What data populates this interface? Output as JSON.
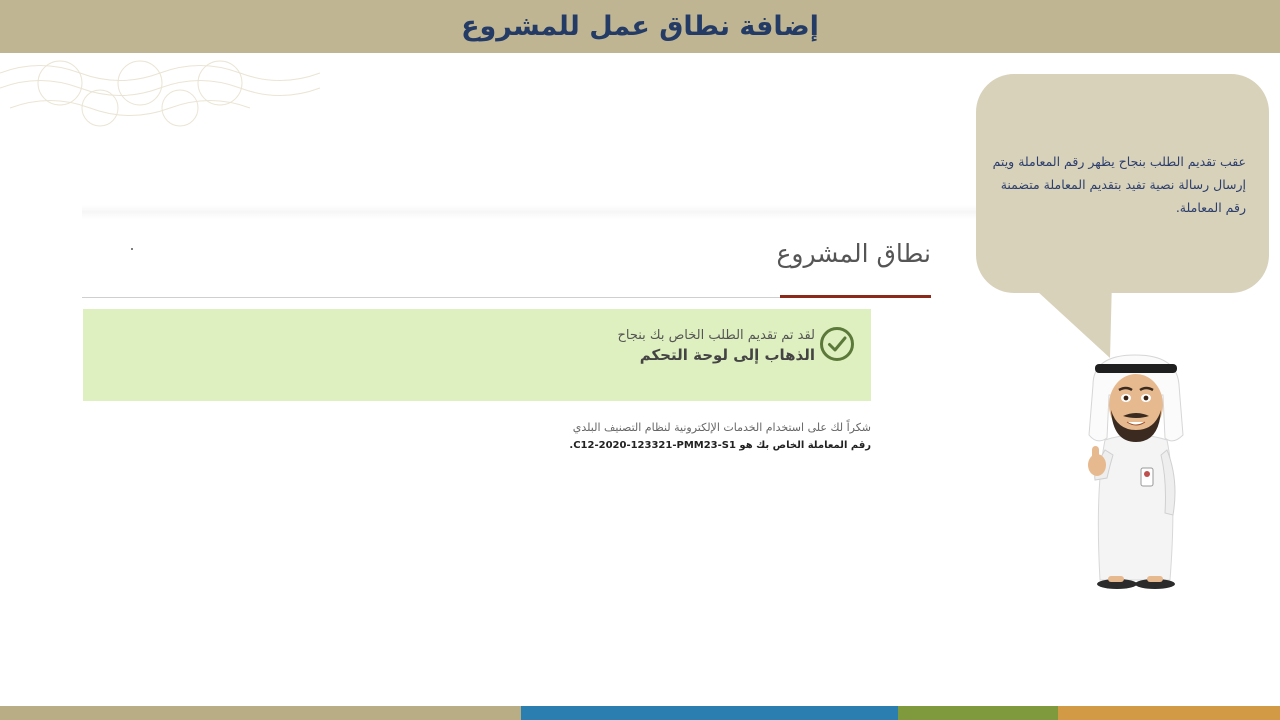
{
  "banner": {
    "title": "إضافة نطاق عمل للمشروع"
  },
  "section": {
    "title": "نطاق المشروع"
  },
  "success": {
    "message": "لقد تم تقديم الطلب الخاص بك بنجاح",
    "link_label": "الذهاب إلى لوحة التحكم",
    "icon": "check-circle-icon"
  },
  "footer_text": {
    "thanks": "شكراً لك على استخدام الخدمات الإلكترونية لنظام التصنيف البلدي",
    "transaction": "رقم المعاملة الخاص بك هو C12-2020-123321-PMM23-S1."
  },
  "bubble": {
    "line1": "عقب تقديم الطلب بنجاح يظهر رقم المعاملة ويتم",
    "line2": "إرسال رسالة نصية تفيد بتقديم المعاملة متضمنة",
    "line3": "رقم المعاملة."
  },
  "colors": {
    "banner": "#bfb592",
    "title": "#243b66",
    "accent": "#8b2a1a",
    "success_bg": "#dff0c0",
    "check": "#5b7a3a",
    "bottom": [
      "#b9ad86",
      "#2a7fb0",
      "#7f9a3c",
      "#d29a44"
    ]
  }
}
